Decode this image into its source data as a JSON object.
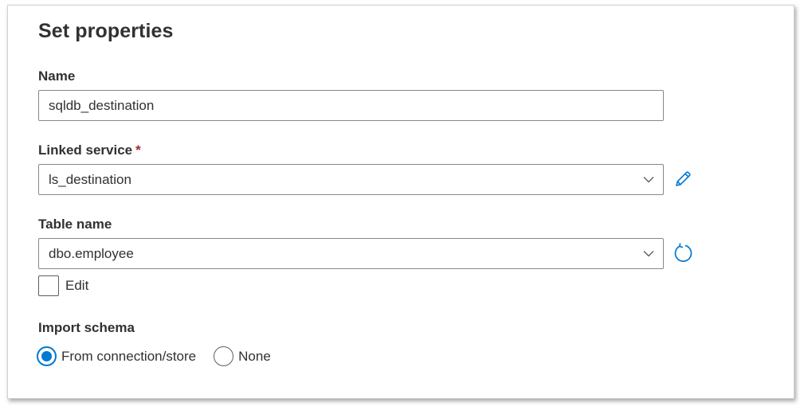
{
  "panel": {
    "title": "Set properties"
  },
  "name": {
    "label": "Name",
    "value": "sqldb_destination"
  },
  "linked_service": {
    "label": "Linked service",
    "required_mark": "*",
    "value": "ls_destination",
    "side_icon": "pencil-icon"
  },
  "table_name": {
    "label": "Table name",
    "value": "dbo.employee",
    "side_icon": "refresh-icon",
    "edit_checkbox_label": "Edit",
    "edit_checked": false
  },
  "import_schema": {
    "label": "Import schema",
    "options": [
      {
        "label": "From connection/store",
        "selected": true
      },
      {
        "label": "None",
        "selected": false
      }
    ]
  },
  "colors": {
    "accent": "#0078d4",
    "required": "#a4262c",
    "text": "#323130",
    "border": "#8a8886"
  }
}
